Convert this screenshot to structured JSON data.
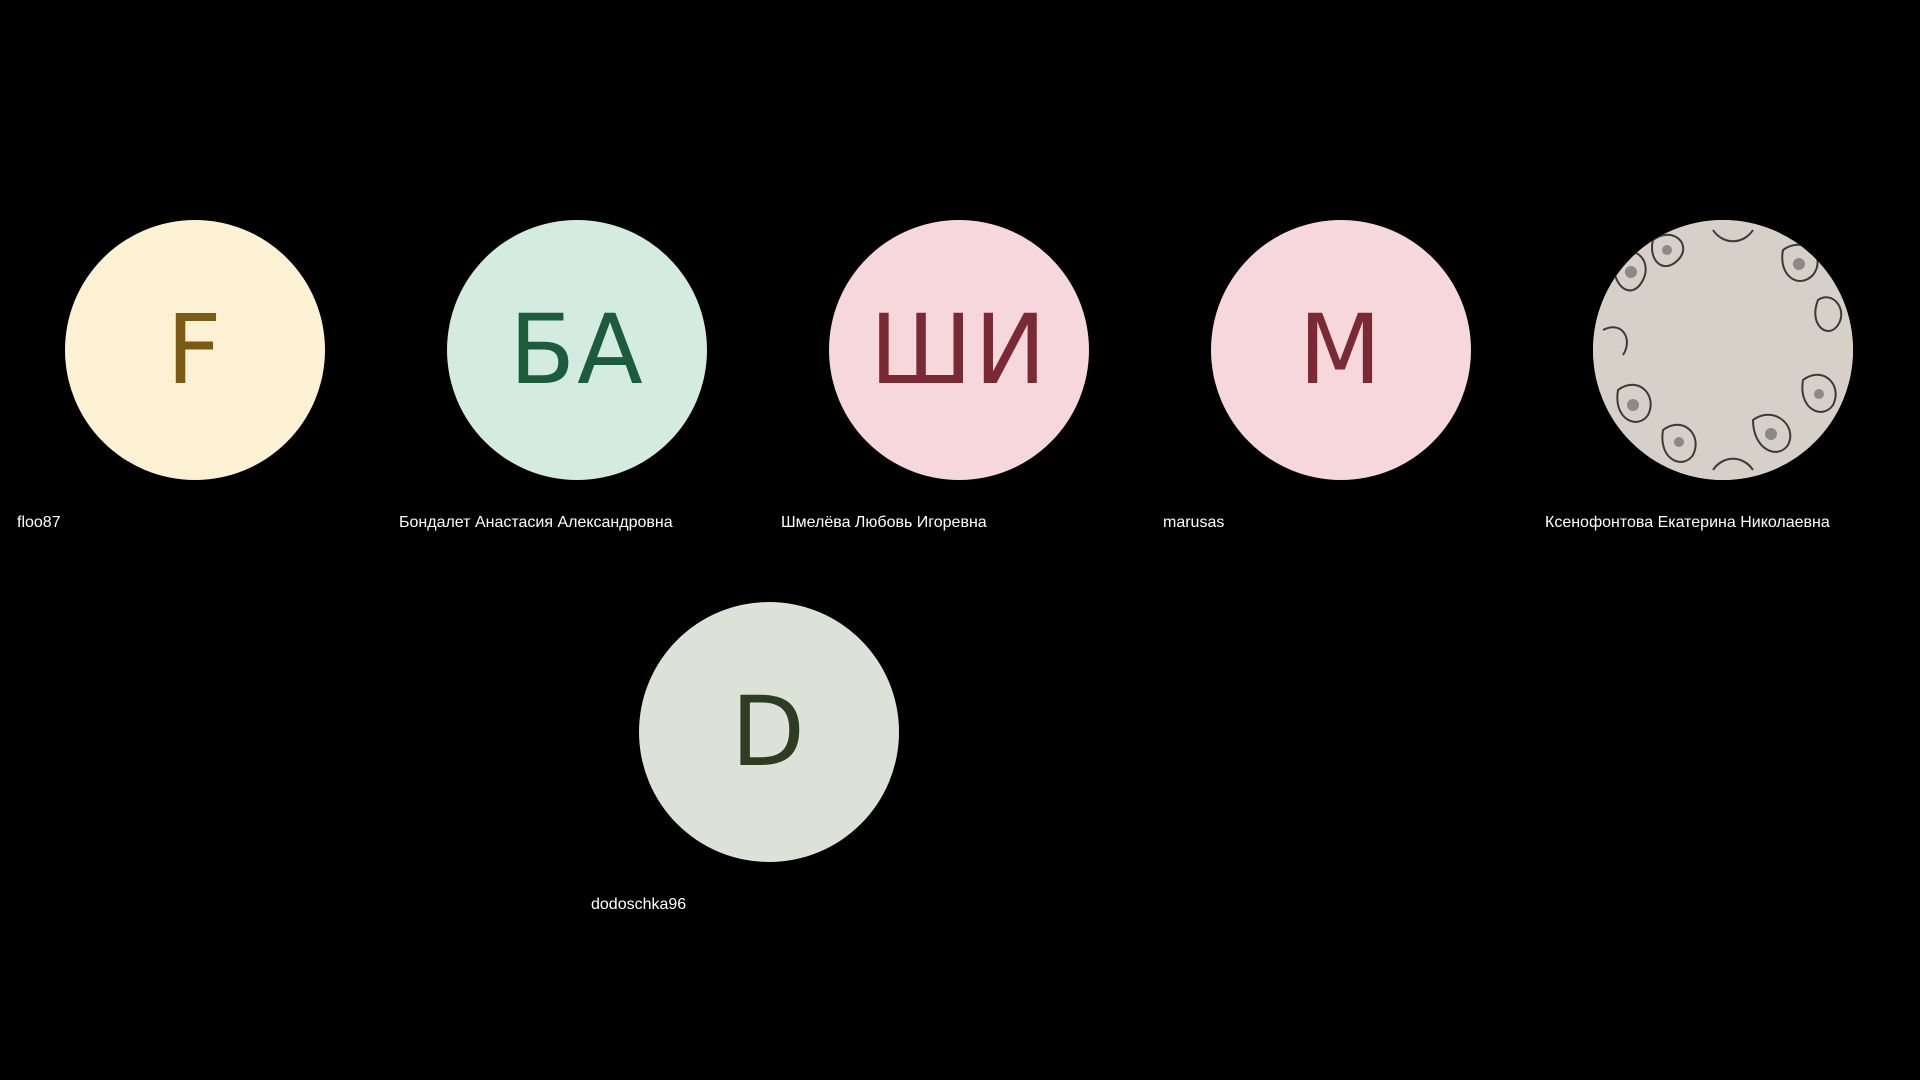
{
  "participants": [
    {
      "initials": "F",
      "name": "floo87",
      "bg": "#fdf1d3",
      "fg": "#7a5a14"
    },
    {
      "initials": "БА",
      "name": "Бондалет Анастасия Александровна",
      "bg": "#d3ebe0",
      "fg": "#1c5c3c"
    },
    {
      "initials": "ШИ",
      "name": "Шмелёва Любовь Игоревна",
      "bg": "#f6d7db",
      "fg": "#7a2a35"
    },
    {
      "initials": "M",
      "name": "marusas",
      "bg": "#f6d7db",
      "fg": "#7a2a35"
    },
    {
      "initials": "",
      "name": "Ксенофонтова Екатерина Николаевна",
      "bg": "#d8d2cb",
      "fg": "#000000",
      "photo": "floral-pattern"
    },
    {
      "initials": "D",
      "name": "dodoschka96",
      "bg": "#dde2d8",
      "fg": "#2d3d22"
    }
  ]
}
